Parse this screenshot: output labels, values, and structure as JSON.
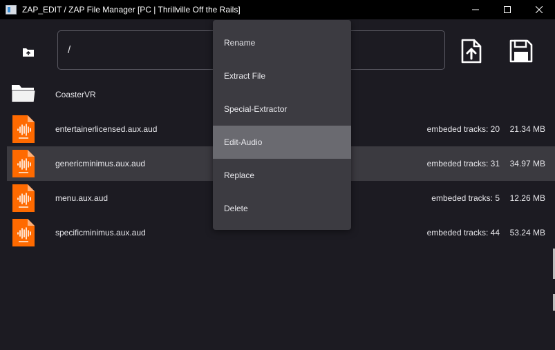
{
  "window": {
    "title": "ZAP_EDIT / ZAP File Manager  [PC | Thrillville Off the Rails]"
  },
  "toolbar": {
    "path_value": "/",
    "up_icon": "folder-up-icon",
    "upload_icon": "file-upload-icon",
    "save_icon": "floppy-save-icon"
  },
  "files": [
    {
      "name": "CoasterVR",
      "type": "folder",
      "tracks": "",
      "size": ""
    },
    {
      "name": "entertainerlicensed.aux.aud",
      "type": "audio",
      "tracks": "embeded tracks: 20",
      "size": "21.34 MB"
    },
    {
      "name": "genericminimus.aux.aud",
      "type": "audio",
      "tracks": "embeded tracks: 31",
      "size": "34.97 MB",
      "selected": true
    },
    {
      "name": "menu.aux.aud",
      "type": "audio",
      "tracks": "embeded tracks: 5",
      "size": "12.26 MB"
    },
    {
      "name": "specificminimus.aux.aud",
      "type": "audio",
      "tracks": "embeded tracks: 44",
      "size": "53.24 MB"
    }
  ],
  "context_menu": {
    "items": [
      {
        "label": "Rename"
      },
      {
        "label": "Extract File"
      },
      {
        "label": "Special-Extractor"
      },
      {
        "label": "Edit-Audio",
        "highlighted": true
      },
      {
        "label": "Replace"
      },
      {
        "label": "Delete"
      }
    ]
  },
  "colors": {
    "background": "#1c1b22",
    "titlebar": "#000000",
    "selected_row": "#3b3a40",
    "menu_bg": "#3c3b41",
    "menu_highlight": "#6a6a70",
    "audio_icon": "#ff6a00"
  }
}
